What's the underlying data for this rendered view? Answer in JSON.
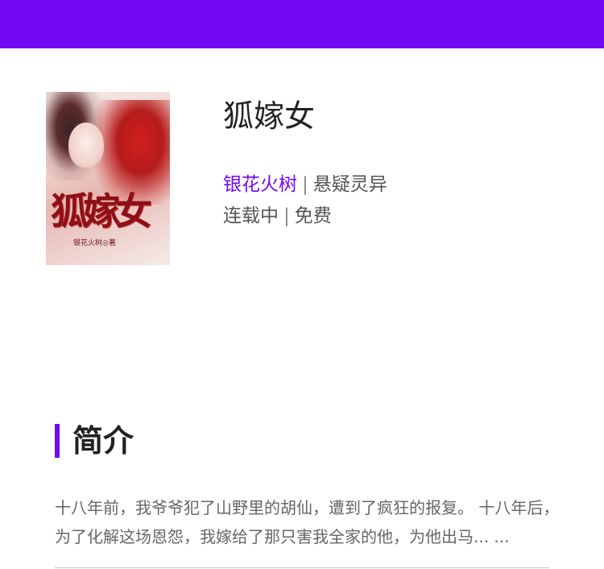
{
  "colors": {
    "accent": "#7309f2",
    "title": "#222222",
    "meta": "#555555",
    "desc": "#666666"
  },
  "header": {
    "bar_color": "#7309f2"
  },
  "book": {
    "cover": {
      "title_art": "狐嫁女",
      "author_art": "银花火树◎著"
    },
    "title": "狐嫁女",
    "author": "银花火树",
    "separator": "|",
    "genre": "悬疑灵异",
    "status": "连载中",
    "price": "免费"
  },
  "intro": {
    "heading": "简介",
    "text": "十八年前，我爷爷犯了山野里的胡仙，遭到了疯狂的报复。 十八年后，为了化解这场恩怨，我嫁给了那只害我全家的他，为他出马... ..."
  }
}
